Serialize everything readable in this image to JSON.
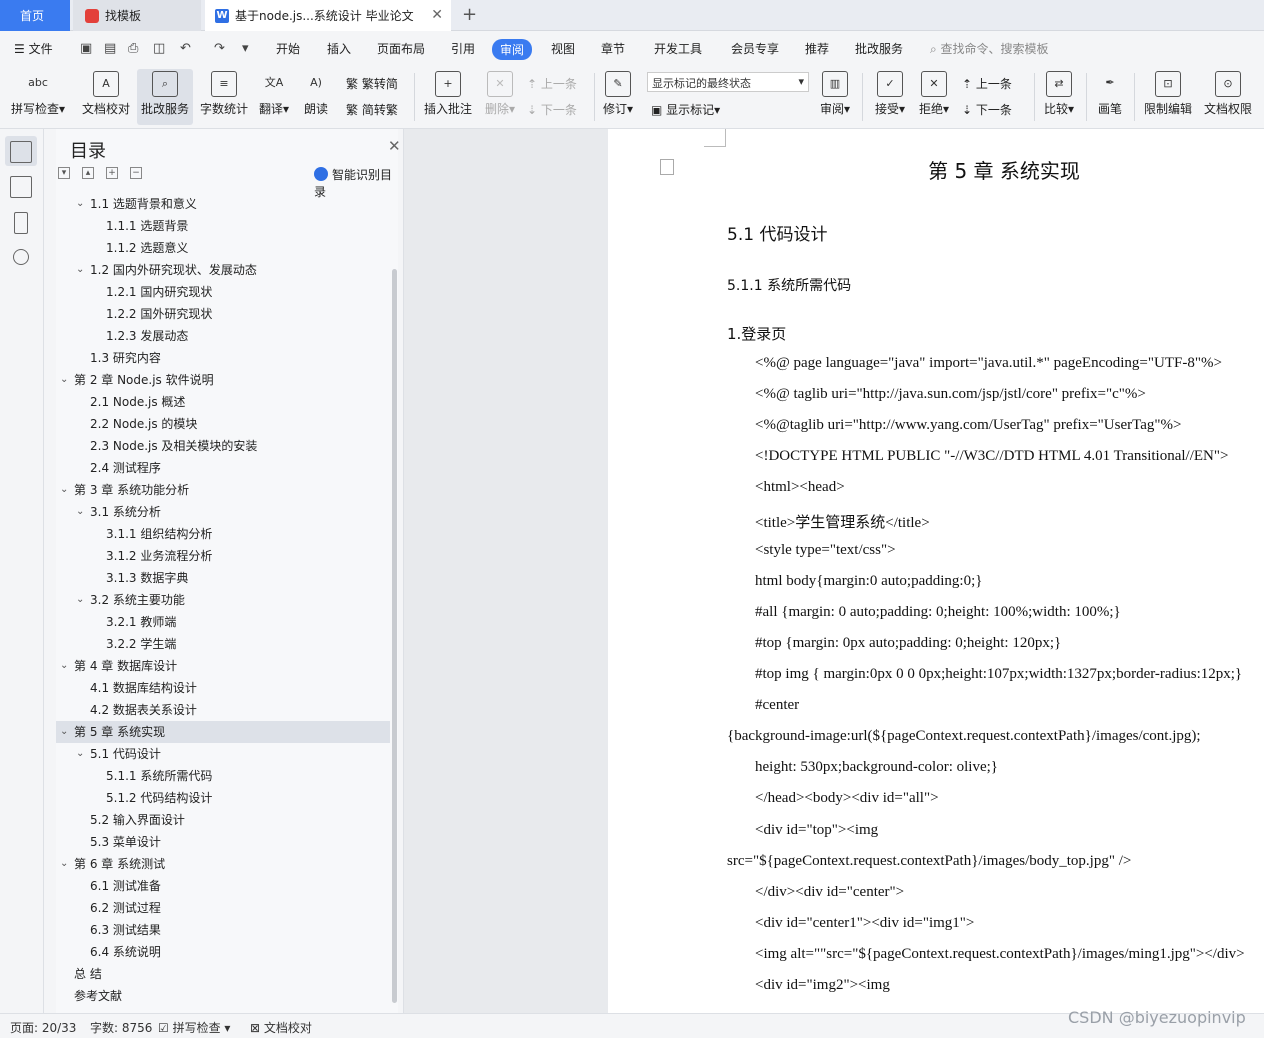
{
  "tabs": {
    "home": "首页",
    "template": "找模板",
    "doc": "基于node.js...系统设计 毕业论文"
  },
  "menu": {
    "file": "文件",
    "items": [
      "开始",
      "插入",
      "页面布局",
      "引用",
      "审阅",
      "视图",
      "章节",
      "开发工具",
      "会员专享",
      "推荐",
      "批改服务"
    ],
    "search_placeholder": "查找命令、搜索模板"
  },
  "ribbon": {
    "spellcheck": "拼写检查",
    "doc_check": "文档校对",
    "review_service": "批改服务",
    "word_count": "字数统计",
    "translate": "翻译",
    "read_aloud": "朗读",
    "to_traditional": "繁转简",
    "to_simplified": "简转繁",
    "insert_comment": "插入批注",
    "delete": "删除",
    "prev": "上一条",
    "next": "下一条",
    "track": "修订",
    "markup_state": "显示标记的最终状态",
    "show_markup": "显示标记",
    "review": "审阅",
    "accept": "接受",
    "reject": "拒绝",
    "prev2": "上一条",
    "next2": "下一条",
    "compare": "比较",
    "pen": "画笔",
    "restrict_edit": "限制编辑",
    "doc_permission": "文档权限",
    "abc": "abc"
  },
  "toc": {
    "title": "目录",
    "smart": "智能识别目录",
    "items": [
      {
        "text": "1.1 选题背景和意义",
        "level": 2,
        "arrow": true
      },
      {
        "text": "1.1.1 选题背景",
        "level": 3,
        "arrow": false
      },
      {
        "text": "1.1.2 选题意义",
        "level": 3,
        "arrow": false
      },
      {
        "text": "1.2 国内外研究现状、发展动态",
        "level": 2,
        "arrow": true
      },
      {
        "text": "1.2.1 国内研究现状",
        "level": 3,
        "arrow": false
      },
      {
        "text": "1.2.2 国外研究现状",
        "level": 3,
        "arrow": false
      },
      {
        "text": "1.2.3 发展动态",
        "level": 3,
        "arrow": false
      },
      {
        "text": "1.3 研究内容",
        "level": 2,
        "arrow": false
      },
      {
        "text": "第 2 章  Node.js 软件说明",
        "level": 1,
        "arrow": true
      },
      {
        "text": "2.1 Node.js 概述",
        "level": 2,
        "arrow": false
      },
      {
        "text": "2.2 Node.js 的模块",
        "level": 2,
        "arrow": false
      },
      {
        "text": "2.3 Node.js 及相关模块的安装",
        "level": 2,
        "arrow": false
      },
      {
        "text": "2.4  测试程序",
        "level": 2,
        "arrow": false
      },
      {
        "text": "第 3 章  系统功能分析",
        "level": 1,
        "arrow": true
      },
      {
        "text": "3.1 系统分析",
        "level": 2,
        "arrow": true
      },
      {
        "text": "3.1.1 组织结构分析",
        "level": 3,
        "arrow": false
      },
      {
        "text": "3.1.2 业务流程分析",
        "level": 3,
        "arrow": false
      },
      {
        "text": "3.1.3 数据字典",
        "level": 3,
        "arrow": false
      },
      {
        "text": "3.2 系统主要功能",
        "level": 2,
        "arrow": true
      },
      {
        "text": "3.2.1  教师端",
        "level": 3,
        "arrow": false
      },
      {
        "text": "3.2.2  学生端",
        "level": 3,
        "arrow": false
      },
      {
        "text": "第 4 章  数据库设计",
        "level": 1,
        "arrow": true
      },
      {
        "text": "4.1 数据库结构设计",
        "level": 2,
        "arrow": false
      },
      {
        "text": "4.2 数据表关系设计",
        "level": 2,
        "arrow": false
      },
      {
        "text": "第 5 章  系统实现",
        "level": 1,
        "arrow": true,
        "selected": true
      },
      {
        "text": "5.1 代码设计",
        "level": 2,
        "arrow": true
      },
      {
        "text": "5.1.1 系统所需代码",
        "level": 3,
        "arrow": false
      },
      {
        "text": "5.1.2 代码结构设计",
        "level": 3,
        "arrow": false
      },
      {
        "text": "5.2 输入界面设计",
        "level": 2,
        "arrow": false
      },
      {
        "text": "5.3 菜单设计",
        "level": 2,
        "arrow": false
      },
      {
        "text": "第 6 章  系统测试",
        "level": 1,
        "arrow": true
      },
      {
        "text": "6.1 测试准备",
        "level": 2,
        "arrow": false
      },
      {
        "text": "6.2 测试过程",
        "level": 2,
        "arrow": false
      },
      {
        "text": "6.3 测试结果",
        "level": 2,
        "arrow": false
      },
      {
        "text": "6.4 系统说明",
        "level": 2,
        "arrow": false
      },
      {
        "text": "总    结",
        "level": 1,
        "arrow": false
      },
      {
        "text": "参考文献",
        "level": 1,
        "arrow": false
      }
    ]
  },
  "doc": {
    "chapter_title": "第 5 章  系统实现",
    "section_title": "5.1 代码设计",
    "subsection_title": "5.1.1 系统所需代码",
    "item_title": "1.登录页",
    "code_lines": [
      {
        "text": "<%@ page language=\"java\" import=\"java.util.*\" pageEncoding=\"UTF-8\"%>",
        "indent": true
      },
      {
        "text": "<%@ taglib uri=\"http://java.sun.com/jsp/jstl/core\" prefix=\"c\"%>",
        "indent": true
      },
      {
        "text": "<%@taglib uri=\"http://www.yang.com/UserTag\" prefix=\"UserTag\"%>",
        "indent": true
      },
      {
        "text": "<!DOCTYPE HTML PUBLIC \"-//W3C//DTD HTML 4.01 Transitional//EN\">",
        "indent": true
      },
      {
        "text": "<html><head>",
        "indent": true
      },
      {
        "text": "<title>学生管理系统</title>",
        "indent": true
      },
      {
        "text": "<style type=\"text/css\">",
        "indent": true
      },
      {
        "text": "html body{margin:0 auto;padding:0;}",
        "indent": true
      },
      {
        "text": "#all {margin: 0 auto;padding: 0;height: 100%;width: 100%;}",
        "indent": true
      },
      {
        "text": "#top {margin: 0px auto;padding: 0;height: 120px;}",
        "indent": true
      },
      {
        "text": "#top img { margin:0px 0 0 0px;height:107px;width:1327px;border-radius:12px;}",
        "indent": true
      },
      {
        "text": "#center",
        "indent": true
      },
      {
        "text": "{background-image:url(${pageContext.request.contextPath}/images/cont.jpg);",
        "indent": false
      },
      {
        "text": "height: 530px;background-color: olive;}",
        "indent": true
      },
      {
        "text": "</head><body><div id=\"all\">",
        "indent": true
      },
      {
        "text": "<div id=\"top\"><img",
        "indent": true
      },
      {
        "text": "src=\"${pageContext.request.contextPath}/images/body_top.jpg\" />",
        "indent": false
      },
      {
        "text": "</div><div id=\"center\">",
        "indent": true
      },
      {
        "text": "<div id=\"center1\"><div id=\"img1\">",
        "indent": true
      },
      {
        "text": "<img alt=\"\"src=\"${pageContext.request.contextPath}/images/ming1.jpg\"></div>",
        "indent": true
      },
      {
        "text": "<div id=\"img2\"><img",
        "indent": true
      }
    ]
  },
  "status": {
    "page": "页面: 20/33",
    "words": "字数: 8756",
    "spellcheck": "拼写检查",
    "doc_check": "文档校对"
  },
  "watermark": "CSDN @biyezuopinvip"
}
